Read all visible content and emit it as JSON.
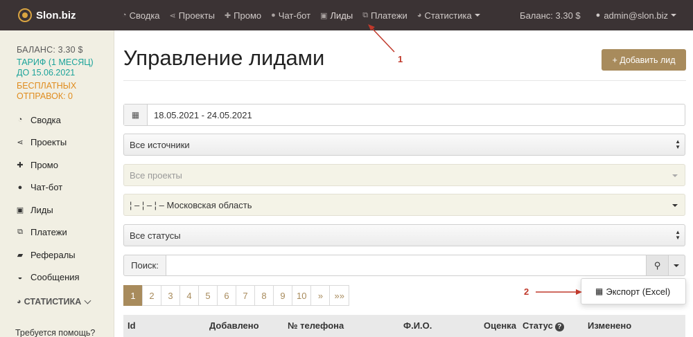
{
  "brand": {
    "name": "Slon.biz"
  },
  "nav": {
    "items": [
      {
        "label": "Сводка",
        "icon": "dashboard-icon",
        "glyph": "◔"
      },
      {
        "label": "Проекты",
        "icon": "share-icon",
        "glyph": "⋖"
      },
      {
        "label": "Промо",
        "icon": "puzzle-icon",
        "glyph": "✚"
      },
      {
        "label": "Чат-бот",
        "icon": "chat-icon",
        "glyph": "●"
      },
      {
        "label": "Лиды",
        "icon": "contact-card-icon",
        "glyph": "▣"
      },
      {
        "label": "Платежи",
        "icon": "payments-icon",
        "glyph": "⧉"
      },
      {
        "label": "Статистика",
        "icon": "pie-chart-icon",
        "glyph": "◕"
      }
    ],
    "balance": "Баланс: 3.30 $",
    "user": "admin@slon.biz"
  },
  "sidebar": {
    "balance": "БАЛАНС: 3.30 $",
    "tariff": "ТАРИФ (1 МЕСЯЦ) ДО 15.06.2021",
    "free": "БЕСПЛАТНЫХ ОТПРАВОК: 0",
    "items": [
      {
        "label": "Сводка",
        "icon": "dashboard-icon",
        "glyph": "◔"
      },
      {
        "label": "Проекты",
        "icon": "share-icon",
        "glyph": "⋖"
      },
      {
        "label": "Промо",
        "icon": "puzzle-icon",
        "glyph": "✚"
      },
      {
        "label": "Чат-бот",
        "icon": "chat-icon",
        "glyph": "●"
      },
      {
        "label": "Лиды",
        "icon": "contact-card-icon",
        "glyph": "▣"
      },
      {
        "label": "Платежи",
        "icon": "payments-icon",
        "glyph": "⧉"
      },
      {
        "label": "Рефералы",
        "icon": "referrals-icon",
        "glyph": "▰"
      },
      {
        "label": "Сообщения",
        "icon": "messages-icon",
        "glyph": "◒"
      }
    ],
    "statistics": "СТАТИСТИКА",
    "help": "Требуется помощь?"
  },
  "main": {
    "title": "Управление лидами",
    "add_button": "+ Добавить лид",
    "date_range": "18.05.2021 - 24.05.2021",
    "filters": {
      "sources": "Все источники",
      "projects": "Все проекты",
      "region": "¦ – ¦ – ¦ – Московская область",
      "statuses": "Все статусы"
    },
    "search": {
      "label": "Поиск:",
      "value": ""
    },
    "pagination": [
      "1",
      "2",
      "3",
      "4",
      "5",
      "6",
      "7",
      "8",
      "9",
      "10",
      "»",
      "»»"
    ],
    "export": "Экспорт (Excel)",
    "table_headers": [
      "Id",
      "Добавлено",
      "№ телефона",
      "Ф.И.О.",
      "Оценка",
      "Статус",
      "Изменено"
    ]
  },
  "annotations": {
    "one": "1",
    "two": "2"
  },
  "colors": {
    "navbar": "#3b3334",
    "accent": "#a88b5c",
    "sidebar": "#f1efe3",
    "tariff": "#1ba39a",
    "free": "#e08c1e",
    "annotation": "#c0392b"
  }
}
